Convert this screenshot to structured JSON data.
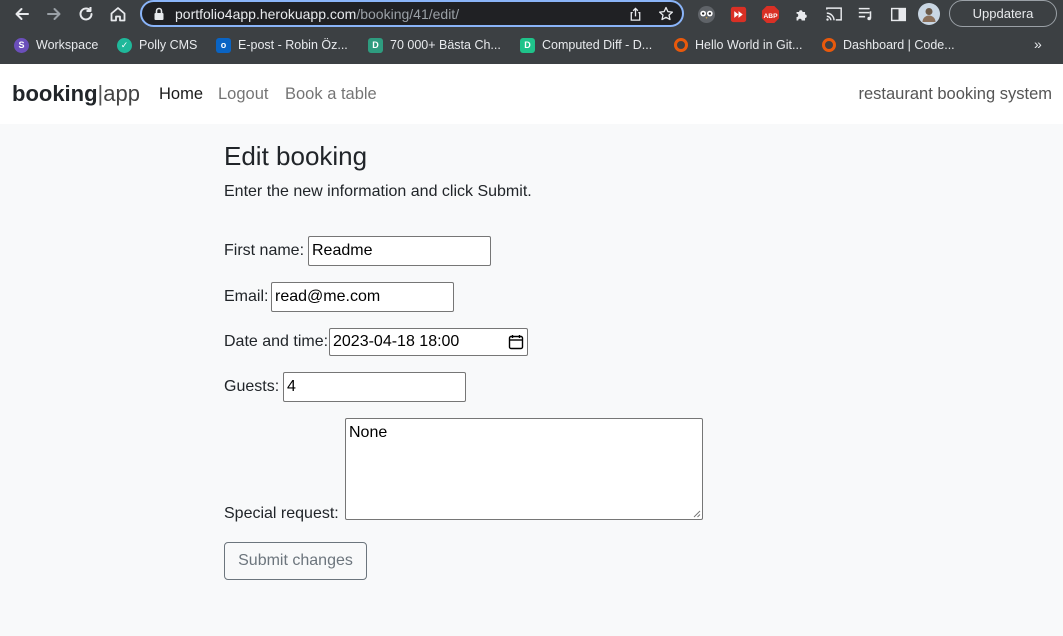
{
  "browser": {
    "url_host": "portfolio4app.herokuapp.com",
    "url_path": "/booking/41/edit/",
    "update_label": "Uppdatera",
    "bookmarks": [
      {
        "label": "Workspace",
        "color": "#6b4fbb"
      },
      {
        "label": "Polly CMS",
        "color": "#1fb89a"
      },
      {
        "label": "E-post - Robin Öz...",
        "color": "#0a64c4"
      },
      {
        "label": "70 000+ Bästa Ch...",
        "color": "#2e9c7f"
      },
      {
        "label": "Computed Diff - D...",
        "color": "#1fc38a"
      },
      {
        "label": "Hello World in Git...",
        "color": "#e8590c"
      },
      {
        "label": "Dashboard | Code...",
        "color": "#e8590c"
      }
    ],
    "bookmarks_more": "»"
  },
  "navbar": {
    "brand_bold": "booking",
    "brand_sep": "|",
    "brand_light": "app",
    "links": [
      {
        "label": "Home",
        "active": true
      },
      {
        "label": "Logout",
        "active": false
      },
      {
        "label": "Book a table",
        "active": false
      }
    ],
    "right_text": "restaurant booking system"
  },
  "page": {
    "title": "Edit booking",
    "intro": "Enter the new information and click Submit."
  },
  "form": {
    "first_name_label": "First name:",
    "first_name_value": "Readme",
    "email_label": "Email:",
    "email_value": "read@me.com",
    "datetime_label": "Date and time:",
    "datetime_value": "2023-04-18 18:00",
    "guests_label": "Guests:",
    "guests_value": "4",
    "special_label": "Special request:",
    "special_value": "None",
    "submit_label": "Submit changes"
  },
  "colors": {
    "chrome_bg": "#3c4043",
    "omnibox_border": "#8ab4f8",
    "page_bg": "#f8f9fa",
    "submit_outline": "#6c757d"
  }
}
